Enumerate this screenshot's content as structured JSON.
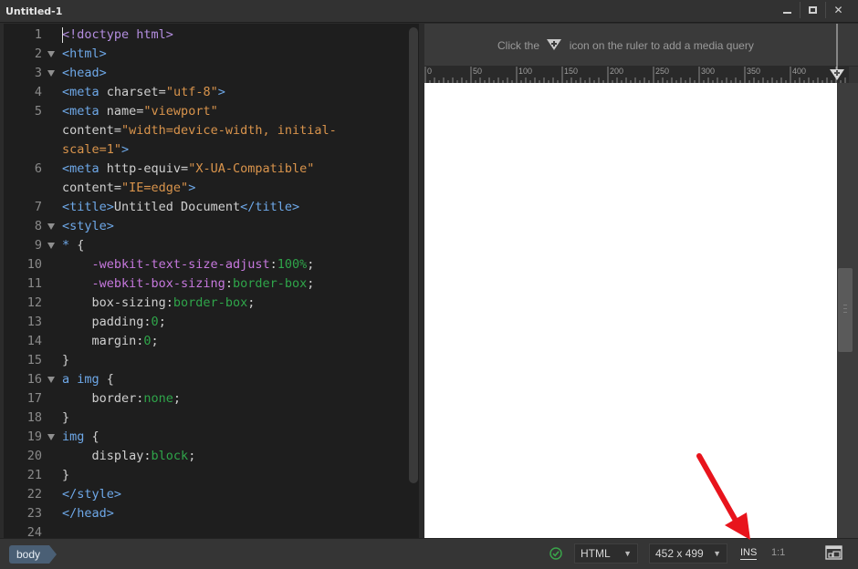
{
  "window": {
    "title": "Untitled-1"
  },
  "window_controls": {
    "minimize_icon": "minimize-icon",
    "maximize_icon": "maximize-icon",
    "close_label": "✕"
  },
  "editor": {
    "lines": [
      {
        "n": "1",
        "fold": false,
        "cursor": true,
        "parts": [
          [
            "t-doc",
            "<!doctype html>"
          ]
        ]
      },
      {
        "n": "2",
        "fold": true,
        "parts": [
          [
            "t-tag",
            "<html>"
          ]
        ]
      },
      {
        "n": "3",
        "fold": true,
        "parts": [
          [
            "t-tag",
            "<head>"
          ]
        ]
      },
      {
        "n": "4",
        "fold": false,
        "parts": [
          [
            "t-tag",
            "<meta "
          ],
          [
            "t-attr",
            "charset="
          ],
          [
            "t-str",
            "\"utf-8\""
          ],
          [
            "t-tag",
            ">"
          ]
        ]
      },
      {
        "n": "5",
        "fold": false,
        "parts": [
          [
            "t-tag",
            "<meta "
          ],
          [
            "t-attr",
            "name="
          ],
          [
            "t-str",
            "\"viewport\""
          ]
        ]
      },
      {
        "n": "",
        "fold": false,
        "parts": [
          [
            "t-attr",
            "content="
          ],
          [
            "t-str",
            "\"width=device-width, initial-"
          ]
        ]
      },
      {
        "n": "",
        "fold": false,
        "parts": [
          [
            "t-str",
            "scale=1\""
          ],
          [
            "t-tag",
            ">"
          ]
        ]
      },
      {
        "n": "6",
        "fold": false,
        "parts": [
          [
            "t-tag",
            "<meta "
          ],
          [
            "t-attr",
            "http-equiv="
          ],
          [
            "t-str",
            "\"X-UA-Compatible\""
          ]
        ]
      },
      {
        "n": "",
        "fold": false,
        "parts": [
          [
            "t-attr",
            "content="
          ],
          [
            "t-str",
            "\"IE=edge\""
          ],
          [
            "t-tag",
            ">"
          ]
        ]
      },
      {
        "n": "7",
        "fold": false,
        "parts": [
          [
            "t-tag",
            "<title>"
          ],
          [
            "t-plain",
            "Untitled Document"
          ],
          [
            "t-tag",
            "</title>"
          ]
        ]
      },
      {
        "n": "8",
        "fold": true,
        "parts": [
          [
            "t-tag",
            "<style>"
          ]
        ]
      },
      {
        "n": "9",
        "fold": true,
        "parts": [
          [
            "t-sel",
            "* "
          ],
          [
            "t-plain",
            "{"
          ]
        ]
      },
      {
        "n": "10",
        "fold": false,
        "parts": [
          [
            "t-plain",
            "    "
          ],
          [
            "t-prop",
            "-webkit-text-size-adjust"
          ],
          [
            "t-plain",
            ":"
          ],
          [
            "t-val",
            "100%"
          ],
          [
            "t-plain",
            ";"
          ]
        ]
      },
      {
        "n": "11",
        "fold": false,
        "parts": [
          [
            "t-plain",
            "    "
          ],
          [
            "t-prop",
            "-webkit-box-sizing"
          ],
          [
            "t-plain",
            ":"
          ],
          [
            "t-val",
            "border-box"
          ],
          [
            "t-plain",
            ";"
          ]
        ]
      },
      {
        "n": "12",
        "fold": false,
        "parts": [
          [
            "t-plain",
            "    box-sizing:"
          ],
          [
            "t-val",
            "border-box"
          ],
          [
            "t-plain",
            ";"
          ]
        ]
      },
      {
        "n": "13",
        "fold": false,
        "parts": [
          [
            "t-plain",
            "    padding:"
          ],
          [
            "t-val",
            "0"
          ],
          [
            "t-plain",
            ";"
          ]
        ]
      },
      {
        "n": "14",
        "fold": false,
        "parts": [
          [
            "t-plain",
            "    margin:"
          ],
          [
            "t-val",
            "0"
          ],
          [
            "t-plain",
            ";"
          ]
        ]
      },
      {
        "n": "15",
        "fold": false,
        "parts": [
          [
            "t-plain",
            "}"
          ]
        ]
      },
      {
        "n": "16",
        "fold": true,
        "parts": [
          [
            "t-sel",
            "a img "
          ],
          [
            "t-plain",
            "{"
          ]
        ]
      },
      {
        "n": "17",
        "fold": false,
        "parts": [
          [
            "t-plain",
            "    border:"
          ],
          [
            "t-val",
            "none"
          ],
          [
            "t-plain",
            ";"
          ]
        ]
      },
      {
        "n": "18",
        "fold": false,
        "parts": [
          [
            "t-plain",
            "}"
          ]
        ]
      },
      {
        "n": "19",
        "fold": true,
        "parts": [
          [
            "t-sel",
            "img "
          ],
          [
            "t-plain",
            "{"
          ]
        ]
      },
      {
        "n": "20",
        "fold": false,
        "parts": [
          [
            "t-plain",
            "    display:"
          ],
          [
            "t-val",
            "block"
          ],
          [
            "t-plain",
            ";"
          ]
        ]
      },
      {
        "n": "21",
        "fold": false,
        "parts": [
          [
            "t-plain",
            "}"
          ]
        ]
      },
      {
        "n": "22",
        "fold": false,
        "parts": [
          [
            "t-tag",
            "</style>"
          ]
        ]
      },
      {
        "n": "23",
        "fold": false,
        "parts": [
          [
            "t-tag",
            "</head>"
          ]
        ]
      },
      {
        "n": "24",
        "fold": false,
        "parts": []
      }
    ]
  },
  "live_view": {
    "media_query_hint_before": "Click the",
    "media_query_hint_after": "icon on the ruler to add a media query",
    "ruler_labels": [
      "0",
      "50",
      "100",
      "150",
      "200",
      "250",
      "300",
      "350",
      "400"
    ]
  },
  "status": {
    "breadcrumb": "body",
    "status_icon": "check-circle-icon",
    "doc_type": "HTML",
    "viewport_size": "452 x 499",
    "insert_mode": "INS",
    "line_col": "1:1",
    "preview_icon": "multiscreen-preview-icon"
  },
  "colors": {
    "accent_arrow": "#e8141c",
    "ok_green": "#3aa34a",
    "breadcrumb_bg": "#4a5f75"
  }
}
